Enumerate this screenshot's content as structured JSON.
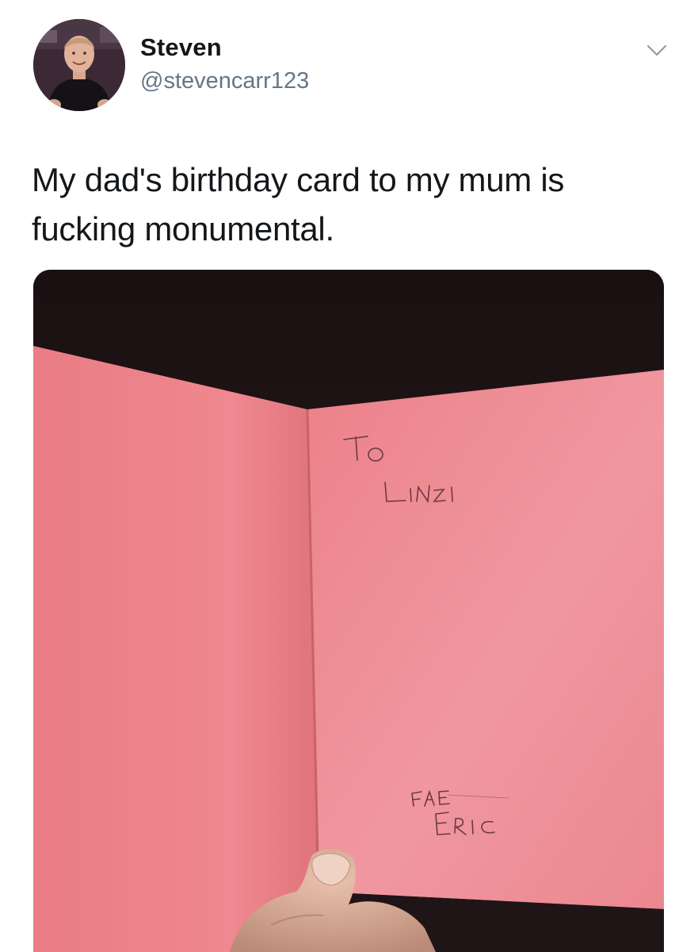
{
  "user": {
    "display_name": "Steven",
    "handle": "@stevencarr123"
  },
  "tweet": {
    "text": "My dad's birthday card to my mum is fucking monumental."
  },
  "media": {
    "description": "",
    "card_handwriting": {
      "line1": "To",
      "line2": "Linzi",
      "line3": "Fae",
      "line4": "Eric"
    }
  },
  "icons": {
    "caret": "chevron-down-icon"
  },
  "colors": {
    "card_pink": "#ec8a92",
    "handle_gray": "#657786",
    "text_dark": "#14171a"
  }
}
